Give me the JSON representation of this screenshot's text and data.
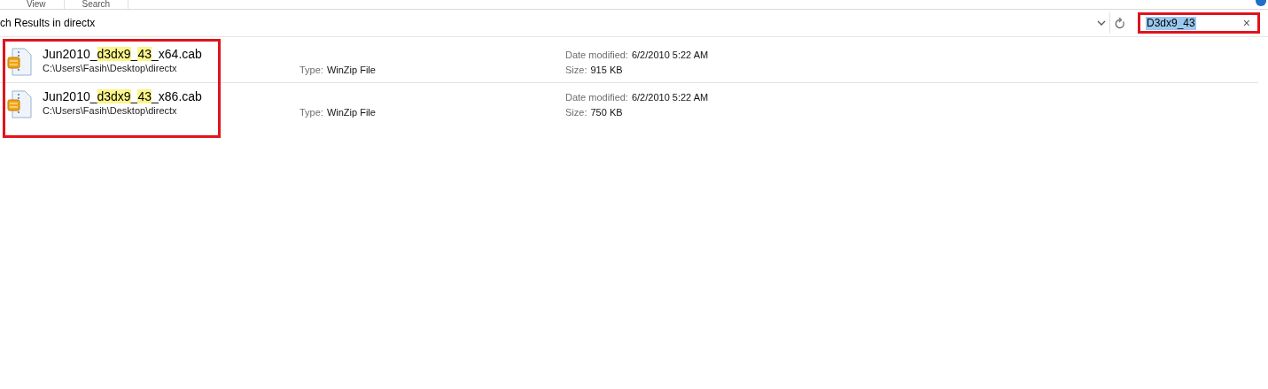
{
  "ribbon_tabs": [
    {
      "label": "View"
    },
    {
      "label": "Search"
    }
  ],
  "address_bar": {
    "text": "ch Results in directx"
  },
  "search": {
    "value": "D3dx9_43",
    "text_selected": true,
    "annotated": true,
    "clear": "×"
  },
  "results_annotated": true,
  "results": [
    {
      "name_parts": [
        {
          "text": "Jun2010_",
          "highlighted": false
        },
        {
          "text": "d3dx9",
          "highlighted": true
        },
        {
          "text": "_",
          "highlighted": false
        },
        {
          "text": "43",
          "highlighted": true
        },
        {
          "text": "_x64.cab",
          "highlighted": false
        }
      ],
      "path": "C:\\Users\\Fasih\\Desktop\\directx",
      "type_label": "Type:",
      "type": "WinZip File",
      "date_label": "Date modified:",
      "date": "6/2/2010 5:22 AM",
      "size_label": "Size:",
      "size": "915 KB"
    },
    {
      "name_parts": [
        {
          "text": "Jun2010_",
          "highlighted": false
        },
        {
          "text": "d3dx9",
          "highlighted": true
        },
        {
          "text": "_",
          "highlighted": false
        },
        {
          "text": "43",
          "highlighted": true
        },
        {
          "text": "_x86.cab",
          "highlighted": false
        }
      ],
      "path": "C:\\Users\\Fasih\\Desktop\\directx",
      "type_label": "Type:",
      "type": "WinZip File",
      "date_label": "Date modified:",
      "date": "6/2/2010 5:22 AM",
      "size_label": "Size:",
      "size": "750 KB"
    }
  ]
}
